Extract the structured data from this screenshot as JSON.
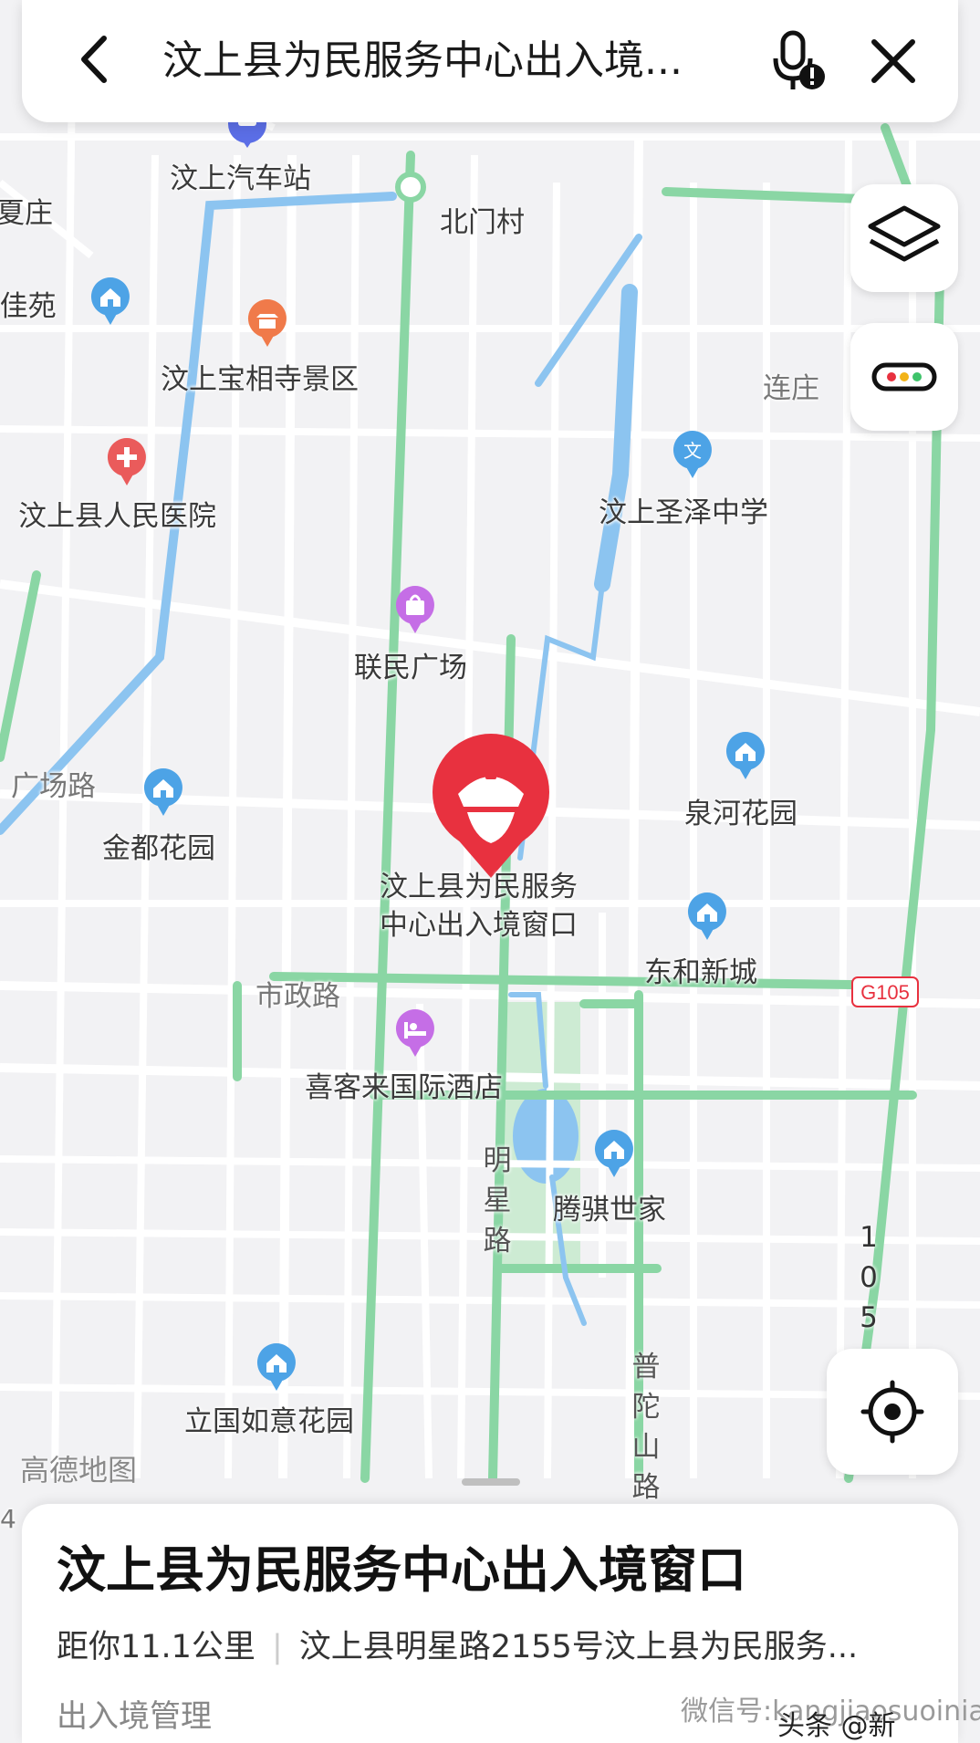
{
  "search": {
    "query": "汶上县为民服务中心出入境..."
  },
  "map": {
    "labels": {
      "bus_station": "汶上汽车站",
      "beimen_village": "北门村",
      "xiazhuang": "夏庄",
      "jiayuan": "n佳苑",
      "baoxiang_temple": "汶上宝相寺景区",
      "lianzhuang": "连庄",
      "hospital": "汶上县人民医院",
      "shengze_school": "汶上圣泽中学",
      "lianmin_plaza": "联民广场",
      "guangchang_road": "广场路",
      "jindu_garden": "金都花园",
      "quanhe_garden": "泉河花园",
      "target_line1": "汶上县为民服务",
      "target_line2": "中心出入境窗口",
      "donghe_city": "东和新城",
      "shizheng_road": "市政路",
      "g105": "G105",
      "xikelai_hotel": "喜客来国际酒店",
      "mingxing_road": [
        "明",
        "星",
        "路"
      ],
      "tengqi_family": "腾骐世家",
      "road_105": [
        "1",
        "0",
        "5"
      ],
      "liguo_garden": "立国如意花园",
      "putuoshan_road": [
        "普",
        "陀",
        "山",
        "路"
      ],
      "amap_logo": "高德地图",
      "edge_4": "4"
    }
  },
  "poi": {
    "title": "汶上县为民服务中心出入境窗口",
    "distance": "距你11.1公里",
    "address": "汶上县明星路2155号汶上县为民服务...",
    "category": "出入境管理"
  },
  "watermark": {
    "line1": "微信号:kangjiaosuoiniao",
    "line2": "头条 @新"
  },
  "colors": {
    "route_green": "#8ad6a4",
    "water_blue": "#8cc4f0",
    "pin_red": "#e8313f",
    "poi_blue": "#4da3e6",
    "poi_orange": "#f07a4a",
    "poi_purple": "#c56ee6"
  }
}
